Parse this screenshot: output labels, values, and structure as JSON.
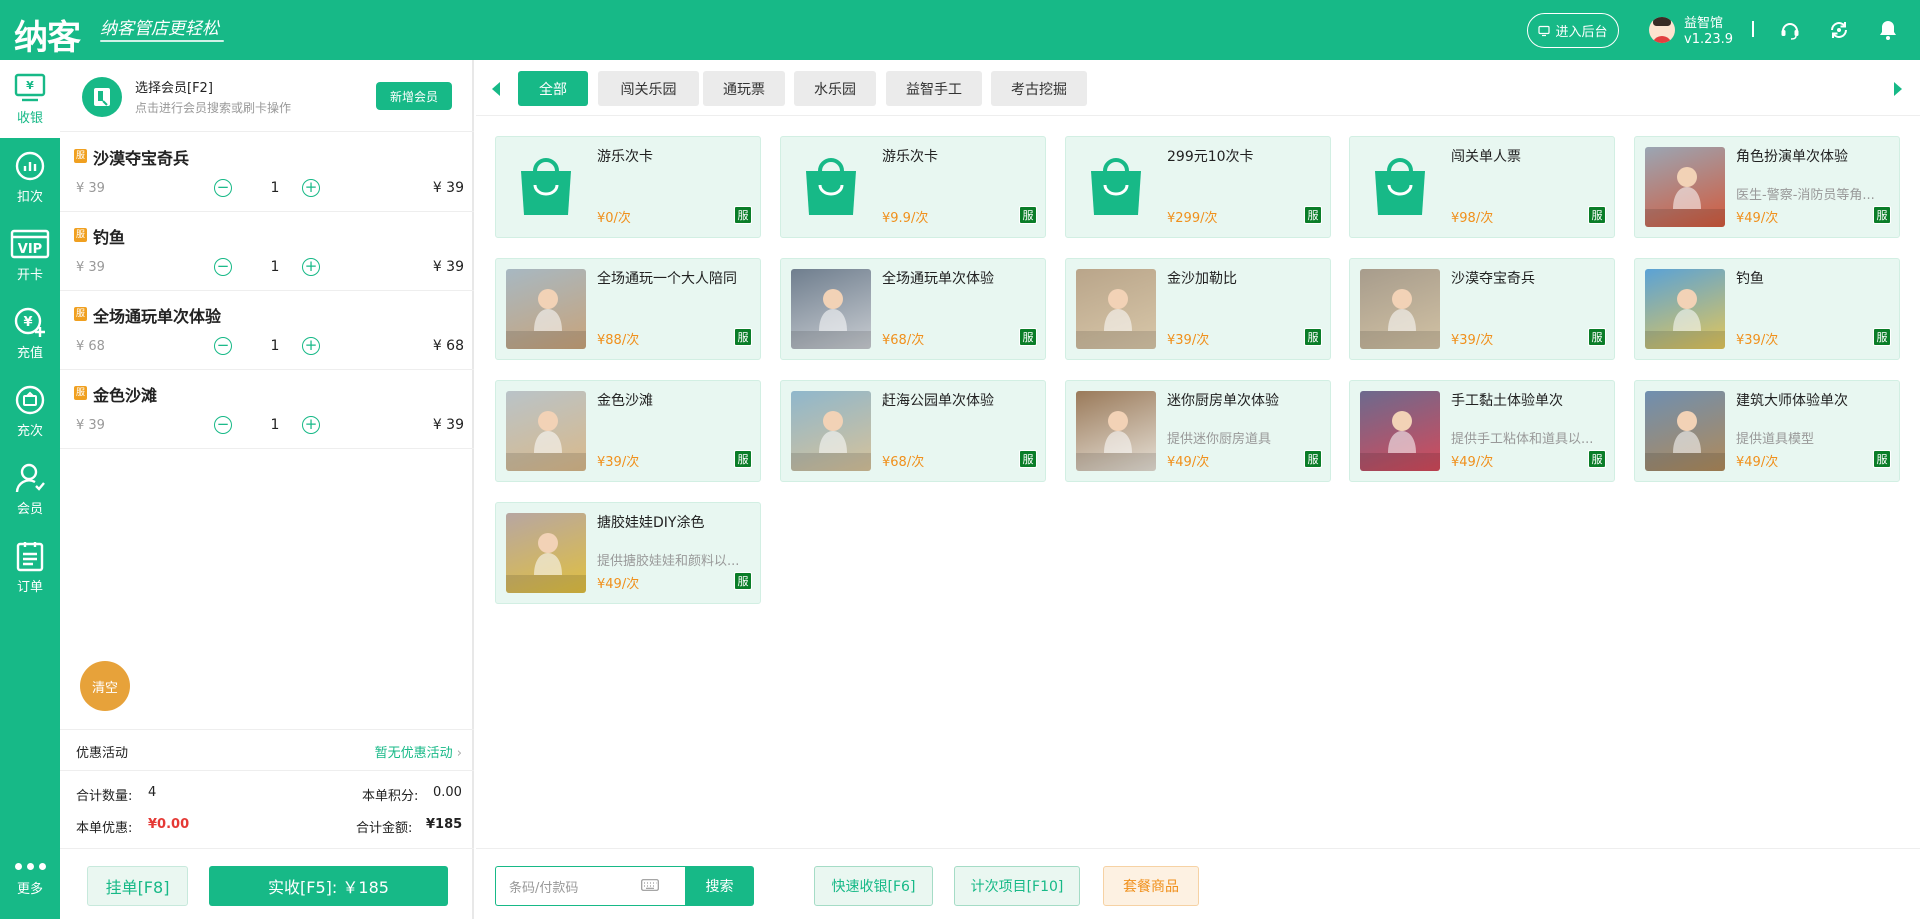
{
  "header": {
    "logo": "纳客",
    "slogan": "纳客管店更轻松",
    "backend_button": "进入后台",
    "store_name": "益智馆",
    "version": "v1.23.9"
  },
  "sidebar": {
    "items": [
      {
        "label": "收银",
        "icon": "cashier-icon"
      },
      {
        "label": "扣次",
        "icon": "chart-icon"
      },
      {
        "label": "开卡",
        "icon": "vip-card-icon"
      },
      {
        "label": "充值",
        "icon": "recharge-icon"
      },
      {
        "label": "充次",
        "icon": "recharge-times-icon"
      },
      {
        "label": "会员",
        "icon": "member-icon"
      },
      {
        "label": "订单",
        "icon": "order-icon"
      }
    ],
    "more": "更多"
  },
  "cart": {
    "member_title": "选择会员[F2]",
    "member_subtitle": "点击进行会员搜索或刷卡操作",
    "new_member": "新增会员",
    "badge": "服",
    "items": [
      {
        "name": "沙漠夺宝奇兵",
        "price": "¥ 39",
        "qty": "1",
        "total": "¥ 39"
      },
      {
        "name": "钓鱼",
        "price": "¥ 39",
        "qty": "1",
        "total": "¥ 39"
      },
      {
        "name": "全场通玩单次体验",
        "price": "¥ 68",
        "qty": "1",
        "total": "¥ 68"
      },
      {
        "name": "金色沙滩",
        "price": "¥ 39",
        "qty": "1",
        "total": "¥ 39"
      }
    ],
    "clear": "清空",
    "promo_label": "优惠活动",
    "promo_value": "暂无优惠活动",
    "total_qty_label": "合计数量:",
    "total_qty": "4",
    "points_label": "本单积分:",
    "points": "0.00",
    "discount_label": "本单优惠:",
    "discount": "¥0.00",
    "amount_label": "合计金额:",
    "amount": "¥185",
    "hold_button": "挂单[F8]",
    "pay_button": "实收[F5]: ￥185"
  },
  "tabs": [
    "全部",
    "闯关乐园",
    "通玩票",
    "水乐园",
    "益智手工",
    "考古挖掘"
  ],
  "products": [
    {
      "name": "游乐次卡",
      "desc": "",
      "price": "¥0/次",
      "tag": "服",
      "thumb": "bag"
    },
    {
      "name": "游乐次卡",
      "desc": "",
      "price": "¥9.9/次",
      "tag": "服",
      "thumb": "bag"
    },
    {
      "name": "299元10次卡",
      "desc": "",
      "price": "¥299/次",
      "tag": "服",
      "thumb": "bag"
    },
    {
      "name": "闯关单人票",
      "desc": "",
      "price": "¥98/次",
      "tag": "服",
      "thumb": "bag"
    },
    {
      "name": "角色扮演单次体验",
      "desc": "医生-警察-消防员等角...",
      "price": "¥49/次",
      "tag": "服",
      "thumb": "photo",
      "c1": "#9aa6b4",
      "c2": "#d35a3c"
    },
    {
      "name": "全场通玩一个大人陪同",
      "desc": "",
      "price": "¥88/次",
      "tag": "服",
      "thumb": "photo",
      "c1": "#a7b8c2",
      "c2": "#c8a37a"
    },
    {
      "name": "全场通玩单次体验",
      "desc": "",
      "price": "¥68/次",
      "tag": "服",
      "thumb": "photo",
      "c1": "#6f7e8e",
      "c2": "#c9cdd2"
    },
    {
      "name": "金沙加勒比",
      "desc": "",
      "price": "¥39/次",
      "tag": "服",
      "thumb": "photo",
      "c1": "#b9a58a",
      "c2": "#d8c7a9"
    },
    {
      "name": "沙漠夺宝奇兵",
      "desc": "",
      "price": "¥39/次",
      "tag": "服",
      "thumb": "photo",
      "c1": "#a79c8c",
      "c2": "#d2c2a4"
    },
    {
      "name": "钓鱼",
      "desc": "",
      "price": "¥39/次",
      "tag": "服",
      "thumb": "photo",
      "c1": "#5aa2d6",
      "c2": "#e2c65a"
    },
    {
      "name": "金色沙滩",
      "desc": "",
      "price": "¥39/次",
      "tag": "服",
      "thumb": "photo",
      "c1": "#b9c3c8",
      "c2": "#d9b98a"
    },
    {
      "name": "赶海公园单次体验",
      "desc": "",
      "price": "¥68/次",
      "tag": "服",
      "thumb": "photo",
      "c1": "#8fb7cc",
      "c2": "#d6c29a"
    },
    {
      "name": "迷你厨房单次体验",
      "desc": "提供迷你厨房道具",
      "price": "¥49/次",
      "tag": "服",
      "thumb": "photo",
      "c1": "#9a7a5a",
      "c2": "#e6e0d6"
    },
    {
      "name": "手工黏土体验单次",
      "desc": "提供手工粘体和道具以...",
      "price": "¥49/次",
      "tag": "服",
      "thumb": "photo",
      "c1": "#6c6a8e",
      "c2": "#d44a5a"
    },
    {
      "name": "建筑大师体验单次",
      "desc": "提供道具模型",
      "price": "¥49/次",
      "tag": "服",
      "thumb": "photo",
      "c1": "#6f8fb0",
      "c2": "#b08a5a"
    },
    {
      "name": "搪胶娃娃DIY涂色",
      "desc": "提供搪胶娃娃和颜料以...",
      "price": "¥49/次",
      "tag": "服",
      "thumb": "photo",
      "c1": "#b7a6a2",
      "c2": "#e0c040"
    }
  ],
  "bottom": {
    "search_placeholder": "条码/付款码",
    "search_button": "搜索",
    "quick_cash": "快速收银[F6]",
    "count_items": "计次项目[F10]",
    "package": "套餐商品"
  },
  "colors": {
    "primary": "#17b987",
    "accent": "#f0901c",
    "danger": "#e53935",
    "tag": "#0a7d28"
  }
}
